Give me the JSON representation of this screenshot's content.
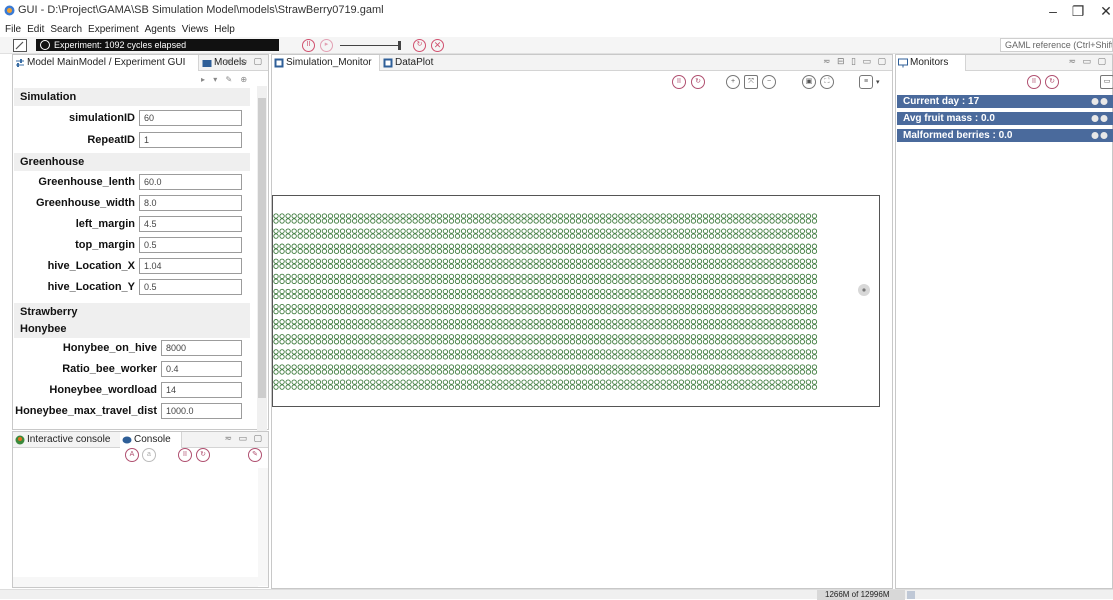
{
  "window": {
    "title": "GUI - D:\\Project\\GAMA\\SB Simulation Model\\models\\StrawBerry0719.gaml",
    "controls": [
      "–",
      "❐",
      "✕"
    ]
  },
  "menu": [
    "File",
    "Edit",
    "Search",
    "Experiment",
    "Agents",
    "Views",
    "Help"
  ],
  "toolbar": {
    "experiment_status": "Experiment: 1092 cycles elapsed",
    "search_placeholder": "GAML reference (Ctrl+Shift+H)"
  },
  "left_pane": {
    "tabs": [
      "Model MainModel / Experiment GUI",
      "Models"
    ],
    "sections": [
      {
        "title": "Simulation",
        "params": [
          {
            "label": "simulationID",
            "value": "60"
          },
          {
            "label": "RepeatID",
            "value": "1"
          }
        ]
      },
      {
        "title": "Greenhouse",
        "params": [
          {
            "label": "Greenhouse_lenth",
            "value": "60.0"
          },
          {
            "label": "Greenhouse_width",
            "value": "8.0"
          },
          {
            "label": "left_margin",
            "value": "4.5"
          },
          {
            "label": "top_margin",
            "value": "0.5"
          },
          {
            "label": "hive_Location_X",
            "value": "1.04"
          },
          {
            "label": "hive_Location_Y",
            "value": "0.5"
          }
        ]
      },
      {
        "title": "Strawberry",
        "params": []
      },
      {
        "title": "Honybee",
        "params": [
          {
            "label": "Honybee_on_hive",
            "value": "8000"
          },
          {
            "label": "Ratio_bee_worker",
            "value": "0.4"
          },
          {
            "label": "Honeybee_wordload",
            "value": "14"
          },
          {
            "label": "Honeybee_max_travel_dist",
            "value": "1000.0"
          }
        ]
      }
    ]
  },
  "console_pane": {
    "tabs": [
      "Interactive console",
      "Console"
    ]
  },
  "center_pane": {
    "tabs": [
      "Simulation_Monitor",
      "DataPlot"
    ]
  },
  "monitors_pane": {
    "tab": "Monitors",
    "monitors": [
      {
        "label": "Current day : 17"
      },
      {
        "label": "Avg fruit mass : 0.0"
      },
      {
        "label": "Malformed berries : 0.0"
      }
    ]
  },
  "status": {
    "memory": "1266M of 12996M"
  },
  "colors": {
    "monitor_bg": "#4a6a9c",
    "plant_fill": "#3c7a3c",
    "accent": "#d0506e"
  }
}
